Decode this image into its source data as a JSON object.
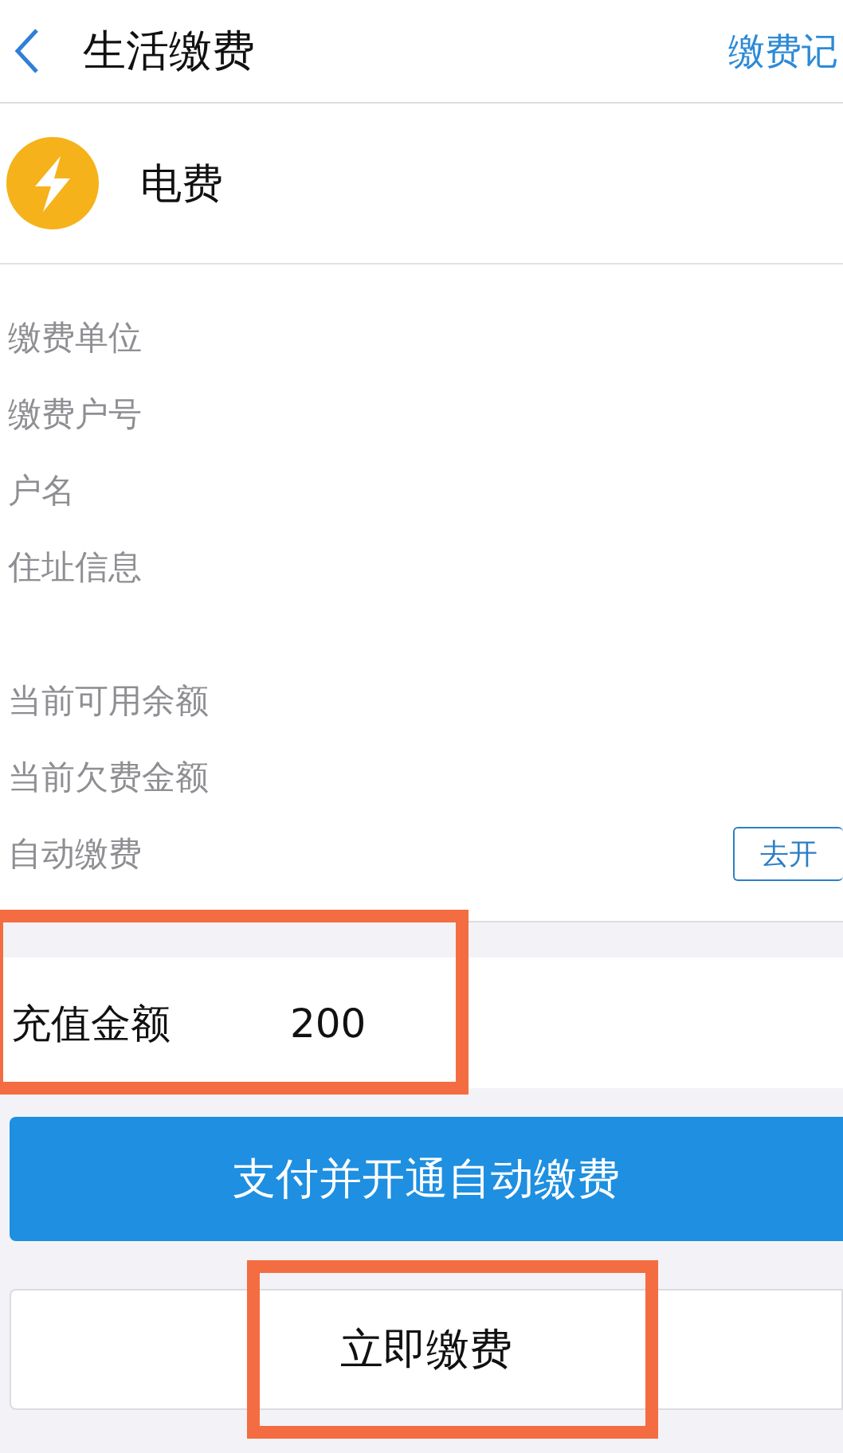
{
  "header": {
    "title": "生活缴费",
    "action": "缴费记"
  },
  "biller": {
    "name": "电费"
  },
  "info_groups": [
    [
      {
        "label": "缴费单位"
      },
      {
        "label": "缴费户号"
      },
      {
        "label": "户名"
      },
      {
        "label": "住址信息"
      }
    ],
    [
      {
        "label": "当前可用余额"
      },
      {
        "label": "当前欠费金额"
      },
      {
        "label": "自动缴费",
        "button": "去开"
      }
    ]
  ],
  "amount": {
    "label": "充值金额",
    "value": "200",
    "highlighted": true
  },
  "buttons": [
    {
      "kind": "primary",
      "label": "支付并开通自动缴费",
      "highlighted": false
    },
    {
      "kind": "secondary",
      "label": "立即缴费",
      "highlighted": true
    }
  ]
}
